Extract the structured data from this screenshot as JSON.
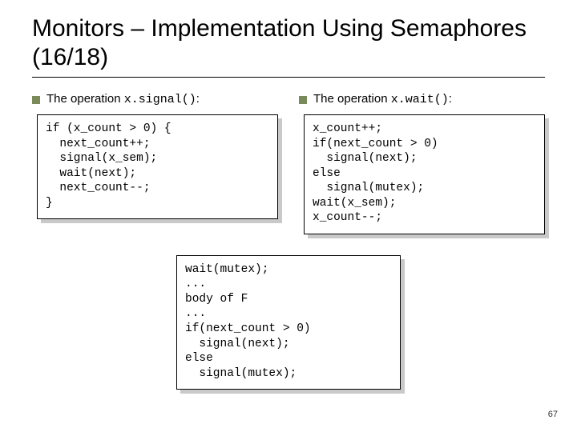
{
  "title": "Monitors – Implementation Using Semaphores (16/18)",
  "left": {
    "label_pre": "The operation ",
    "label_code": "x.signal()",
    "label_post": ":",
    "code": "if (x_count > 0) {\n  next_count++;\n  signal(x_sem);\n  wait(next);\n  next_count--;\n}"
  },
  "right": {
    "label_pre": "The operation ",
    "label_code": "x.wait()",
    "label_post": ":",
    "code": "x_count++;\nif(next_count > 0)\n  signal(next);\nelse\n  signal(mutex);\nwait(x_sem);\nx_count--;"
  },
  "bottom": {
    "code": "wait(mutex);\n...\nbody of F\n...\nif(next_count > 0)\n  signal(next);\nelse\n  signal(mutex);"
  },
  "page": "67"
}
